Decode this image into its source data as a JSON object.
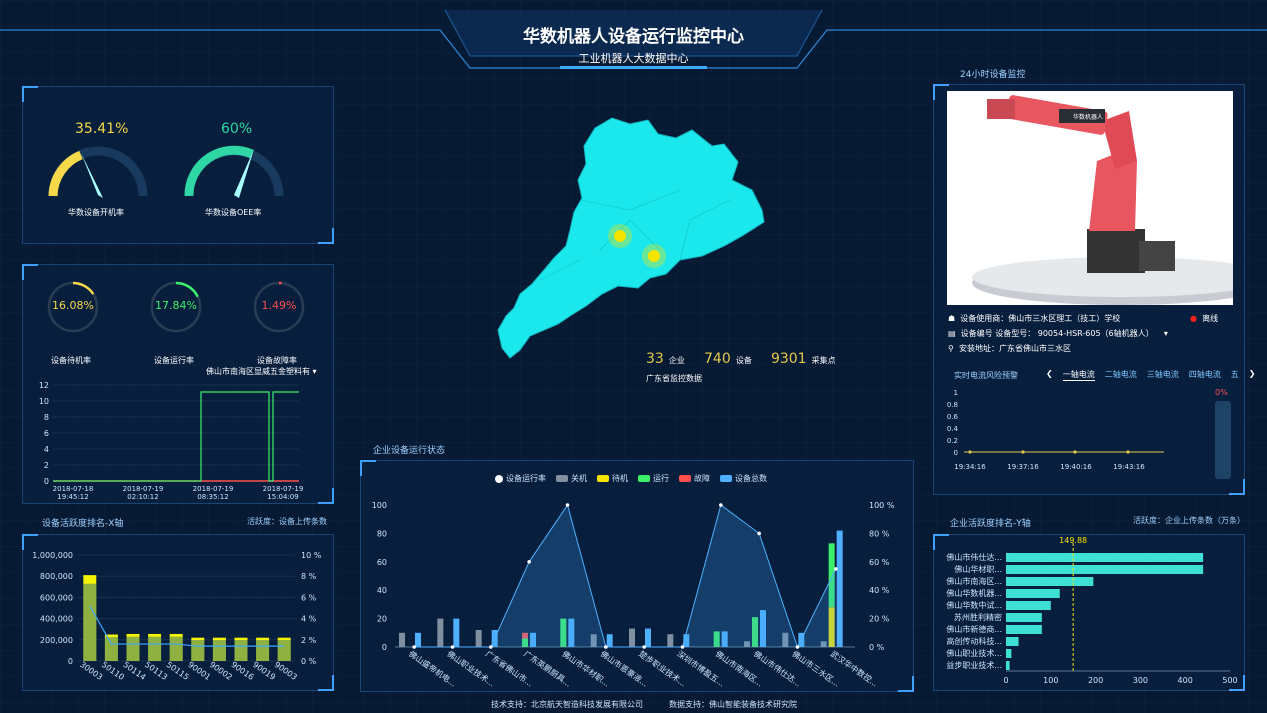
{
  "header": {
    "title": "华数机器人设备运行监控中心",
    "subtitle": "工业机器人大数据中心"
  },
  "gauges": [
    {
      "value": "35.41%",
      "label": "华数设备开机率",
      "pct": 35.41,
      "color": "#f7d84a"
    },
    {
      "value": "60%",
      "label": "华数设备OEE率",
      "pct": 60,
      "color": "#2ed7a4"
    }
  ],
  "rings": [
    {
      "value": "16.08%",
      "label": "设备待机率",
      "pct": 16.08,
      "color": "#f7d84a"
    },
    {
      "value": "17.84%",
      "label": "设备运行率",
      "pct": 17.84,
      "color": "#3cf06a"
    },
    {
      "value": "1.49%",
      "label": "设备故障率",
      "pct": 1.49,
      "color": "#ff5050"
    }
  ],
  "company_select": "佛山市南海区显威五金塑料有",
  "status_chart": {
    "yticks": [
      "12",
      "10",
      "8",
      "6",
      "4",
      "2",
      "0"
    ],
    "xticks": [
      [
        "2018-07-18",
        "19:45:12"
      ],
      [
        "2018-07-19",
        "02:10:12"
      ],
      [
        "2018-07-19",
        "08:35:12"
      ],
      [
        "2018-07-19",
        "15:04:09"
      ]
    ]
  },
  "activity_x": {
    "title": "设备活跃度排名-X轴",
    "note": "活跃度：设备上传条数",
    "yticks": [
      "1,000,000",
      "800,000",
      "600,000",
      "400,000",
      "200,000",
      "0"
    ],
    "y2ticks": [
      "10 %",
      "8 %",
      "6 %",
      "4 %",
      "2 %",
      "0 %"
    ],
    "chart_data": {
      "type": "bar",
      "categories": [
        "30003",
        "50110",
        "50114",
        "50113",
        "50115",
        "90001",
        "90002",
        "90016",
        "90019",
        "90003"
      ],
      "values": [
        810000,
        250000,
        255000,
        255000,
        255000,
        220000,
        220000,
        220000,
        220000,
        220000
      ],
      "line_pct": [
        5.2,
        1.6,
        1.6,
        1.6,
        1.6,
        1.4,
        1.4,
        1.4,
        1.4,
        1.4
      ],
      "ylim": [
        0,
        1000000
      ]
    }
  },
  "map": {
    "stats": [
      {
        "num": "33",
        "unit": "企业"
      },
      {
        "num": "740",
        "unit": "设备"
      },
      {
        "num": "9301",
        "unit": "采集点"
      }
    ],
    "caption": "广东省监控数据"
  },
  "status_section": {
    "title": "企业设备运行状态",
    "legend": [
      {
        "name": "设备运行率",
        "color": "#ffffff"
      },
      {
        "name": "关机",
        "color": "#8090a0"
      },
      {
        "name": "待机",
        "color": "#f5e400"
      },
      {
        "name": "运行",
        "color": "#3cf06a"
      },
      {
        "name": "故障",
        "color": "#ff5050"
      },
      {
        "name": "设备总数",
        "color": "#4fb0ff"
      }
    ],
    "yticks": [
      "100",
      "80",
      "60",
      "40",
      "20",
      "0"
    ],
    "y2ticks": [
      "100 %",
      "80 %",
      "60 %",
      "40 %",
      "20 %",
      "0 %"
    ],
    "chart_data": {
      "type": "bar",
      "categories": [
        "佛山盛帝机电...",
        "佛山职业技术...",
        "广东省佛山市...",
        "广东英鹏厨具...",
        "佛山市华材职...",
        "佛山市恩豪液...",
        "楚步职业技术...",
        "深圳市博盈五...",
        "佛山市南海区...",
        "佛山市伟仕达...",
        "佛山市三水区...",
        "武汉华中数控..."
      ],
      "series": [
        {
          "name": "关机",
          "values": [
            10,
            20,
            12,
            0,
            0,
            9,
            13,
            9,
            0,
            4,
            10,
            4
          ]
        },
        {
          "name": "待机",
          "values": [
            0,
            0,
            0,
            0,
            0,
            0,
            0,
            0,
            0,
            0,
            0,
            28
          ]
        },
        {
          "name": "运行",
          "values": [
            0,
            0,
            0,
            6,
            20,
            0,
            0,
            0,
            11,
            21,
            0,
            45
          ]
        },
        {
          "name": "故障",
          "values": [
            0,
            0,
            0,
            4,
            0,
            0,
            0,
            0,
            0,
            0,
            0,
            0
          ]
        },
        {
          "name": "设备总数",
          "values": [
            10,
            20,
            12,
            10,
            20,
            9,
            13,
            9,
            11,
            26,
            10,
            82
          ]
        },
        {
          "name": "设备运行率",
          "values": [
            0,
            0,
            0,
            60,
            100,
            0,
            0,
            0,
            100,
            80,
            0,
            55
          ]
        }
      ],
      "ylim": [
        0,
        100
      ]
    }
  },
  "robot": {
    "title": "24小时设备监控",
    "user": "设备使用商：佛山市三水区理工（技工）学校",
    "status": "离线",
    "model": "设备编号 设备型号：  90054-HSR-605（6轴机器人）",
    "address": "安装地址：广东省佛山市三水区",
    "brand": "华数机器人"
  },
  "current": {
    "title": "实时电流风险预警",
    "tabs": [
      "一轴电流",
      "二轴电流",
      "三轴电流",
      "四轴电流",
      "五"
    ],
    "pct": "0%",
    "yticks": [
      "1",
      "0.8",
      "0.6",
      "0.4",
      "0.2",
      "0"
    ],
    "xticks": [
      "19:34:16",
      "19:37:16",
      "19:40:16",
      "19:43:16"
    ]
  },
  "activity_y": {
    "title": "企业活跃度排名-Y轴",
    "note": "活跃度：企业上传条数（万条）",
    "marker": "149.88",
    "xticks": [
      "0",
      "100",
      "200",
      "300",
      "400",
      "500"
    ],
    "chart_data": {
      "type": "bar",
      "categories": [
        "佛山市伟仕达...",
        "佛山华材职...",
        "佛山市南海区...",
        "佛山华数机器...",
        "佛山华数中试...",
        "苏州胜利精密",
        "佛山市新德商...",
        "高创传动科技...",
        "佛山职业技术...",
        "益步职业技术..."
      ],
      "values": [
        440,
        440,
        195,
        120,
        100,
        80,
        80,
        28,
        12,
        8
      ],
      "xlim": [
        0,
        500
      ]
    }
  },
  "footer": {
    "tech": "技术支持：北京航天智造科技发展有限公司",
    "data": "数据支持：佛山智能装备技术研究院"
  }
}
